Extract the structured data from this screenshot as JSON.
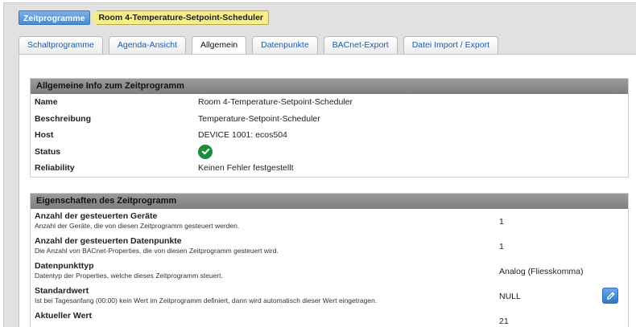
{
  "breadcrumb": {
    "root": "Zeitprogramme",
    "current": "Room 4-Temperature-Setpoint-Scheduler"
  },
  "tabs": [
    {
      "label": "Schaltprogramme",
      "active": false
    },
    {
      "label": "Agenda-Ansicht",
      "active": false
    },
    {
      "label": "Allgemein",
      "active": true
    },
    {
      "label": "Datenpunkte",
      "active": false
    },
    {
      "label": "BACnet-Export",
      "active": false
    },
    {
      "label": "Datei Import / Export",
      "active": false
    }
  ],
  "general_info": {
    "title": "Allgemeine Info zum Zeitprogramm",
    "rows": [
      {
        "label": "Name",
        "value": "Room 4-Temperature-Setpoint-Scheduler"
      },
      {
        "label": "Beschreibung",
        "value": "Temperature-Setpoint-Scheduler"
      },
      {
        "label": "Host",
        "value": "DEVICE 1001: ecos504"
      },
      {
        "label": "Status",
        "value": "",
        "icon": "check-circle-icon",
        "status_color": "#1e8c3a"
      },
      {
        "label": "Reliability",
        "value": "Keinen Fehler festgestellt"
      }
    ]
  },
  "properties": {
    "title": "Eigenschaften des Zeitprogramm",
    "rows": [
      {
        "label": "Anzahl der gesteuerten Geräte",
        "desc": "Anzahl der Geräte, die von diesen Zeitprogramm gesteuert werden.",
        "value": "1"
      },
      {
        "label": "Anzahl der gesteuerten Datenpunkte",
        "desc": "Die Anzahl von BACnet-Properties, die von diesen Zeitprogramm gesteuert wird.",
        "value": "1"
      },
      {
        "label": "Datenpunkttyp",
        "desc": "Datentyp der Properties, welche dieses Zeitprogramm steuert.",
        "value": "Analog (Fliesskomma)"
      },
      {
        "label": "Standardwert",
        "desc": "Ist bei Tagesanfang (00:00) kein Wert im Zeitprogramm definiert, dann wird automatisch dieser Wert eingetragen.",
        "value": "NULL",
        "editable": true,
        "edit_icon": "pencil-icon"
      },
      {
        "label": "Aktueller Wert",
        "desc": "",
        "value": "21"
      }
    ]
  },
  "colors": {
    "accent": "#4a89cf",
    "breadcrumb_current_bg": "#f7ef86",
    "header_bar": "#8a8a8a",
    "status_ok": "#1e8c3a"
  }
}
